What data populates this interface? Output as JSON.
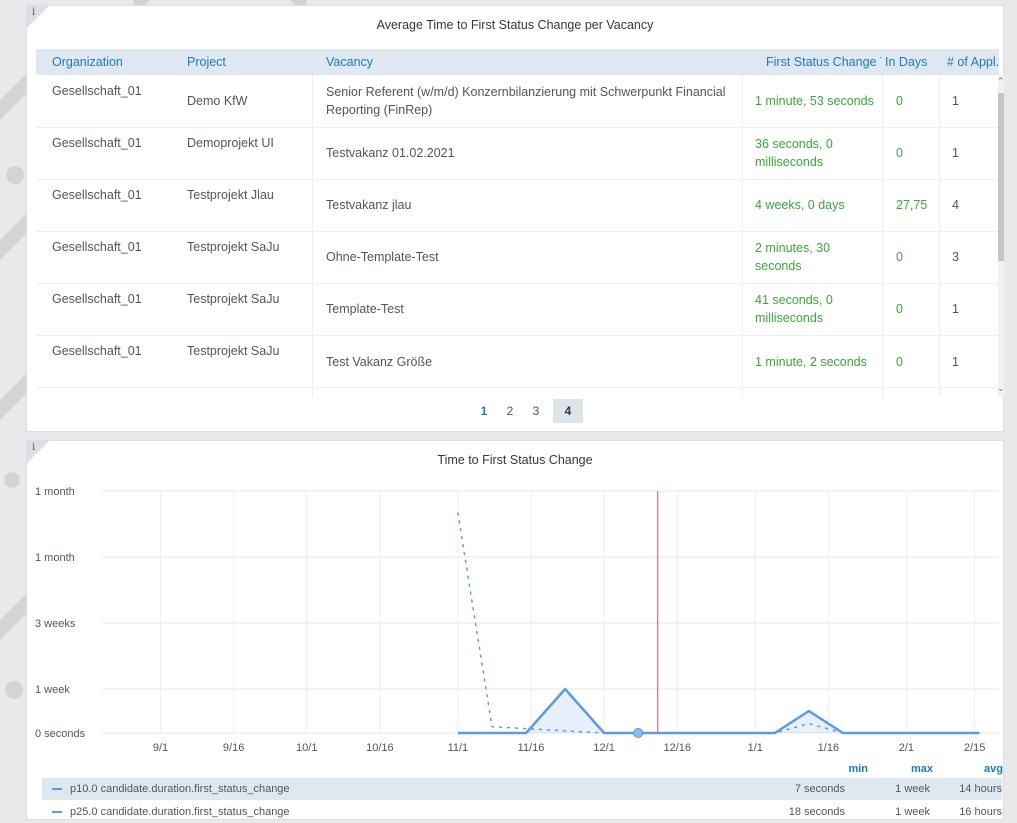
{
  "table_panel": {
    "info_label": "i",
    "title": "Average Time to First Status Change per Vacancy",
    "columns": [
      "Organization",
      "Project",
      "Vacancy",
      "First Status Change Time",
      "In Days",
      "# of Appl."
    ],
    "rows": [
      {
        "org": "Gesellschaft_01",
        "project": "Demo KfW",
        "vacancy": "Senior Referent (w/m/d) Konzernbilanzierung mit Schwerpunkt Financial Reporting (FinRep)",
        "first_status": "1 minute, 53 seconds",
        "days": "0",
        "apps": "1"
      },
      {
        "org": "Gesellschaft_01",
        "project": "Demoprojekt UI",
        "vacancy": "Testvakanz 01.02.2021",
        "first_status": "36 seconds, 0 milliseconds",
        "days": "0",
        "apps": "1"
      },
      {
        "org": "Gesellschaft_01",
        "project": "Testprojekt Jlau",
        "vacancy": "Testvakanz jlau",
        "first_status": "4 weeks, 0 days",
        "days": "27,75",
        "apps": "4"
      },
      {
        "org": "Gesellschaft_01",
        "project": "Testprojekt SaJu",
        "vacancy": "Ohne-Template-Test",
        "first_status": "2 minutes, 30 seconds",
        "days": "0",
        "apps": "3"
      },
      {
        "org": "Gesellschaft_01",
        "project": "Testprojekt SaJu",
        "vacancy": "Template-Test",
        "first_status": "41 seconds, 0 milliseconds",
        "days": "0",
        "apps": "1"
      },
      {
        "org": "Gesellschaft_01",
        "project": "Testprojekt SaJu",
        "vacancy": "Test Vakanz Größe",
        "first_status": "1 minute, 2 seconds",
        "days": "0",
        "apps": "1"
      }
    ],
    "pagination": {
      "pages": [
        "1",
        "2",
        "3",
        "4"
      ],
      "current": "1",
      "active": "4"
    }
  },
  "chart_panel": {
    "info_label": "i",
    "title": "Time to First Status Change",
    "legend_columns": {
      "min": "min",
      "max": "max",
      "avg": "avg"
    },
    "legend": [
      {
        "name": "p10.0 candidate.duration.first_status_change",
        "min": "7 seconds",
        "max": "1 week",
        "avg": "14 hours"
      },
      {
        "name": "p25.0 candidate.duration.first_status_change",
        "min": "18 seconds",
        "max": "1 week",
        "avg": "16 hours"
      }
    ]
  },
  "chart_data": {
    "type": "line",
    "title": "Time to First Status Change",
    "x_ticks": [
      "9/1",
      "9/16",
      "10/1",
      "10/16",
      "11/1",
      "11/16",
      "12/1",
      "12/16",
      "1/1",
      "1/16",
      "2/1",
      "2/15"
    ],
    "y_ticks": [
      "0 seconds",
      "1 week",
      "3 weeks",
      "1 month",
      "1 month"
    ],
    "y_tick_values_days": [
      0,
      7,
      17.5,
      28,
      38.5
    ],
    "ylim_days": [
      0,
      38.5
    ],
    "xlim": [
      "2020-08-20",
      "2021-02-20"
    ],
    "grid": true,
    "now_marker": "2020-12-12",
    "series": [
      {
        "name": "p10.0 candidate.duration.first_status_change",
        "color": "#5b9be5",
        "x": [
          "2020-11-01",
          "2020-11-08",
          "2020-11-15",
          "2020-11-23",
          "2020-12-01",
          "2020-12-08",
          "2020-12-15",
          "2020-12-22",
          "2021-01-05",
          "2021-01-12",
          "2021-01-19",
          "2021-01-26",
          "2021-02-02",
          "2021-02-09",
          "2021-02-16"
        ],
        "values": [
          0,
          0,
          0,
          7,
          0,
          0,
          0,
          0,
          0,
          3.5,
          0,
          0,
          0,
          0,
          0
        ]
      },
      {
        "name": "p25.0 candidate.duration.first_status_change",
        "color": "#5b9be5",
        "style": "dotted",
        "x": [
          "2020-11-01",
          "2020-11-08",
          "2020-12-01",
          "2020-12-22",
          "2021-01-05",
          "2021-01-12",
          "2021-01-19",
          "2021-02-16"
        ],
        "values": [
          35,
          1,
          0,
          0,
          0,
          1.5,
          0,
          0
        ]
      }
    ],
    "colors": {
      "accent": "#1c7ac4",
      "value_green": "#3ba63b",
      "line": "#5b9be5",
      "marker": "#d9534f"
    }
  }
}
